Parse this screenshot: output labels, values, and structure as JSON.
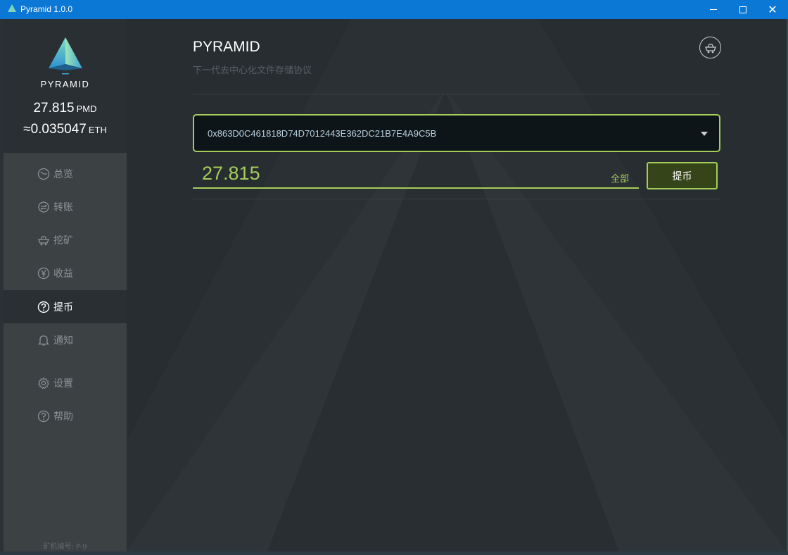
{
  "window": {
    "title": "Pyramid 1.0.0"
  },
  "sidebar": {
    "brand": "PYRAMID",
    "balance_pmd": "27.815",
    "balance_pmd_unit": "PMD",
    "balance_eth": "≈0.035047",
    "balance_eth_unit": "ETH",
    "items": [
      {
        "label": "总览",
        "icon": "clock-icon"
      },
      {
        "label": "转账",
        "icon": "transfer-icon"
      },
      {
        "label": "挖矿",
        "icon": "mining-cart-icon"
      },
      {
        "label": "收益",
        "icon": "coin-icon"
      },
      {
        "label": "提币",
        "icon": "question-circle-icon",
        "active": true
      },
      {
        "label": "通知",
        "icon": "bell-icon"
      },
      {
        "label": "设置",
        "icon": "gear-icon"
      },
      {
        "label": "帮助",
        "icon": "help-icon"
      }
    ],
    "miner_id": "矿机编号: P-9"
  },
  "main": {
    "title": "PYRAMID",
    "subtitle": "下一代去中心化文件存储协议",
    "address": "0x863D0C461818D74D7012443E362DC21B7E4A9C5B",
    "amount": "27.815",
    "all_label": "全部",
    "withdraw_label": "提币"
  },
  "colors": {
    "accent": "#a5cc59",
    "titlebar": "#0b78d6",
    "sidebar": "#3c4144",
    "sidebar_dark": "#2a2f33",
    "main_bg": "#272d31"
  }
}
